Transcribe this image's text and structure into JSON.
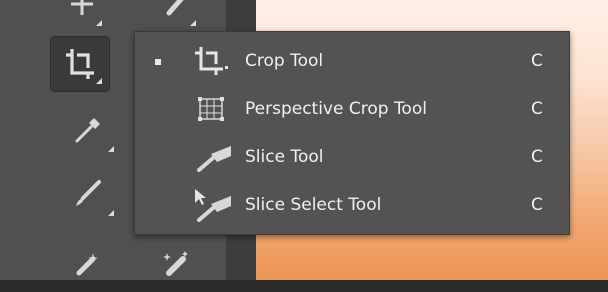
{
  "toolbar": {
    "tools": [
      {
        "name": "move-tool-icon"
      },
      {
        "name": "brush-tool-icon"
      },
      {
        "name": "crop-tool-icon",
        "active": true
      },
      {
        "name": "eyedropper-tool-icon"
      },
      {
        "name": "brush-tool-icon"
      },
      {
        "name": "healing-tool-icon"
      },
      {
        "name": "magic-eraser-tool-icon"
      }
    ]
  },
  "flyout": {
    "items": [
      {
        "label": "Crop Tool",
        "shortcut": "C",
        "icon": "crop-icon",
        "selected": true
      },
      {
        "label": "Perspective Crop Tool",
        "shortcut": "C",
        "icon": "perspective-crop-icon",
        "selected": false
      },
      {
        "label": "Slice Tool",
        "shortcut": "C",
        "icon": "slice-icon",
        "selected": false
      },
      {
        "label": "Slice Select Tool",
        "shortcut": "C",
        "icon": "slice-select-icon",
        "selected": false
      }
    ]
  },
  "colors": {
    "toolbar_bg": "#505050",
    "flyout_bg": "#535353",
    "active_tool_bg": "#3a3a3a",
    "text": "#f0f0f0"
  }
}
